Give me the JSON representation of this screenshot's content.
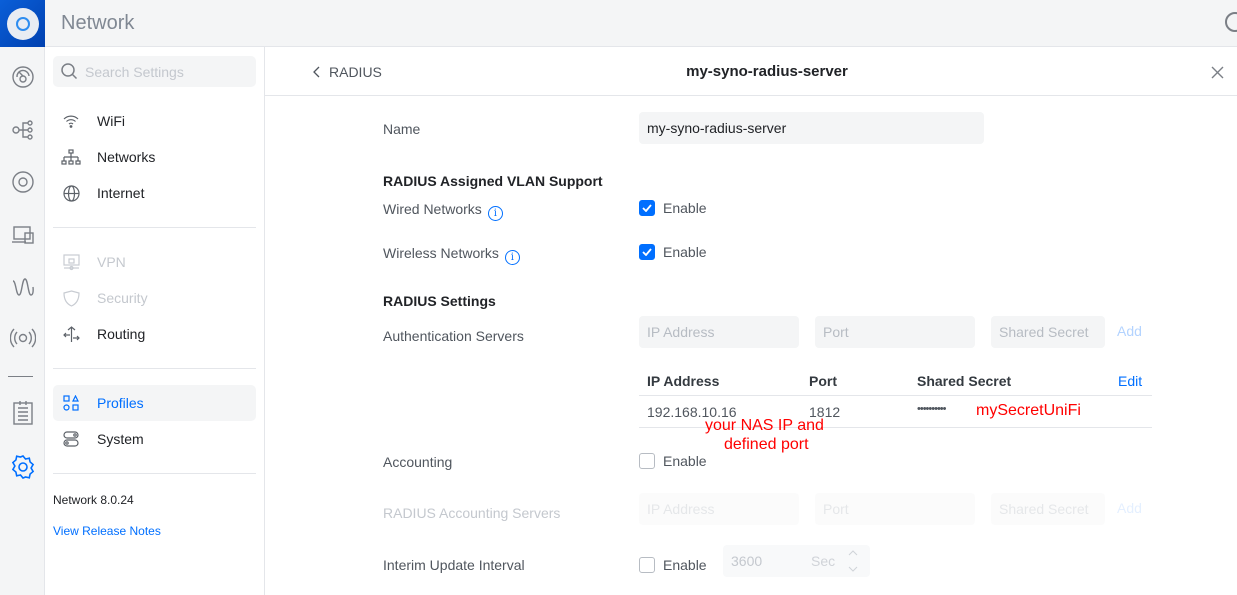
{
  "app": {
    "title": "Network"
  },
  "rail": {
    "icons": [
      "dashboard-icon",
      "topology-icon",
      "devices-icon",
      "clients-icon",
      "insights-icon",
      "radio-icon",
      "logs-icon",
      "settings-icon"
    ]
  },
  "sidebar": {
    "search_placeholder": "Search Settings",
    "items": [
      {
        "label": "WiFi",
        "icon": "wifi-icon",
        "state": "normal"
      },
      {
        "label": "Networks",
        "icon": "networks-icon",
        "state": "normal"
      },
      {
        "label": "Internet",
        "icon": "globe-icon",
        "state": "normal"
      },
      {
        "label": "VPN",
        "icon": "vpn-icon",
        "state": "disabled"
      },
      {
        "label": "Security",
        "icon": "shield-icon",
        "state": "disabled"
      },
      {
        "label": "Routing",
        "icon": "routing-icon",
        "state": "normal"
      },
      {
        "label": "Profiles",
        "icon": "profiles-icon",
        "state": "active"
      },
      {
        "label": "System",
        "icon": "system-icon",
        "state": "normal"
      }
    ],
    "version": "Network 8.0.24",
    "release_notes": "View Release Notes"
  },
  "main": {
    "back_label": "RADIUS",
    "title": "my-syno-radius-server",
    "name_label": "Name",
    "name_value": "my-syno-radius-server",
    "vlan_section": "RADIUS Assigned VLAN Support",
    "wired_label": "Wired Networks",
    "wireless_label": "Wireless Networks",
    "enable": "Enable",
    "wired_enabled": true,
    "wireless_enabled": true,
    "settings_section": "RADIUS Settings",
    "auth_label": "Authentication Servers",
    "ip_placeholder": "IP Address",
    "port_placeholder": "Port",
    "secret_placeholder": "Shared Secret",
    "add": "Add",
    "table": {
      "headers": [
        "IP Address",
        "Port",
        "Shared Secret"
      ],
      "edit": "Edit",
      "rows": [
        {
          "ip": "192.168.10.16",
          "port": "1812",
          "secret": "••••••••••"
        }
      ]
    },
    "annotation_secret": "mySecretUniFi",
    "annotation_ip_1": "your NAS IP and",
    "annotation_ip_2": "defined port",
    "accounting_label": "Accounting",
    "accounting_enabled": false,
    "acct_servers_label": "RADIUS Accounting Servers",
    "interim_label": "Interim Update Interval",
    "interim_enabled": false,
    "interim_value": "3600",
    "interim_unit": "Sec"
  },
  "colors": {
    "accent": "#006fff",
    "annotation": "#ff0000"
  }
}
